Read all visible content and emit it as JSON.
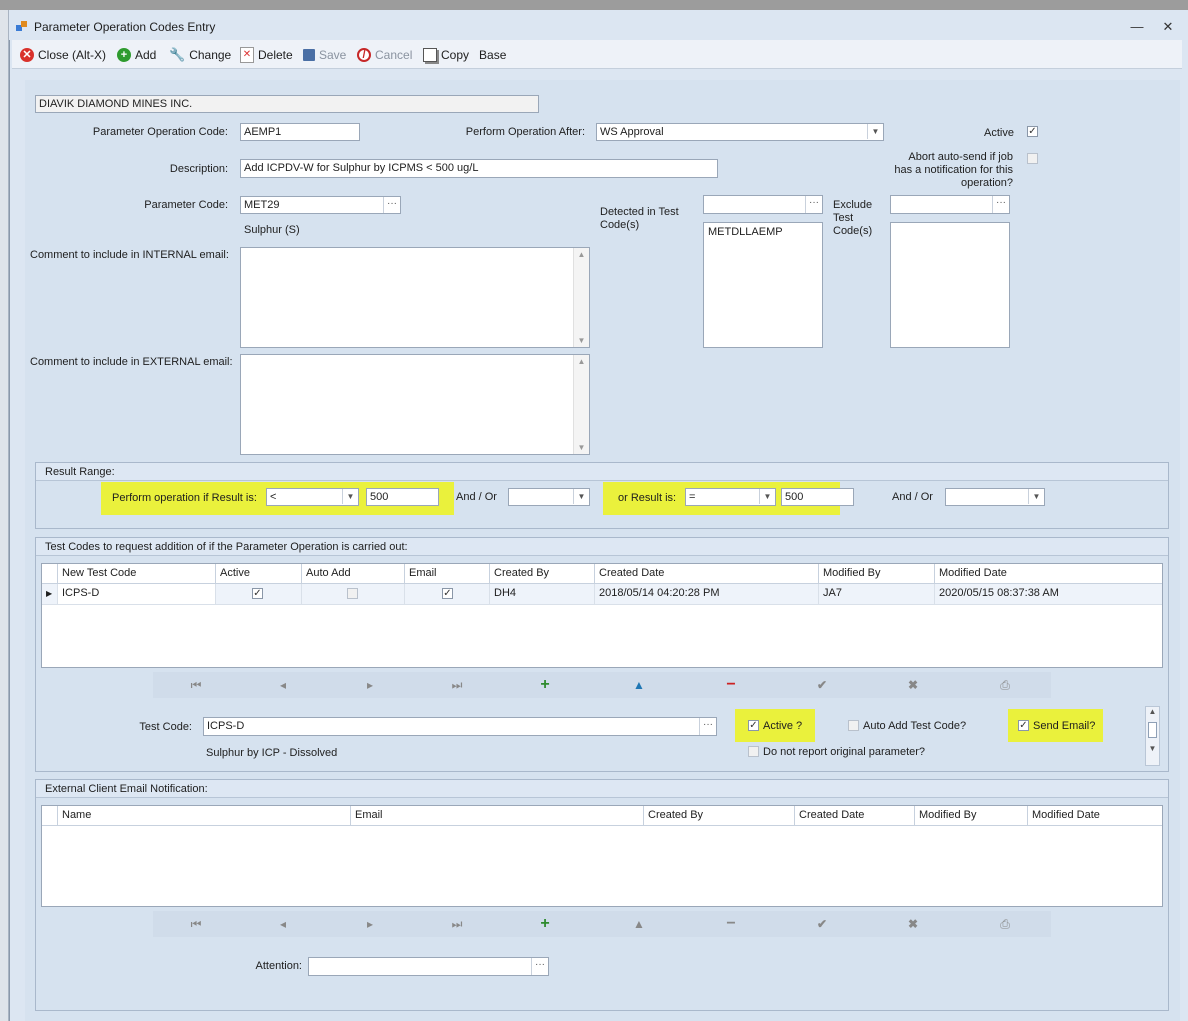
{
  "window": {
    "title": "Parameter Operation Codes Entry",
    "minimize": "—",
    "close": "✕"
  },
  "toolbar": {
    "close_label": "Close (Alt-X)",
    "add_label": "Add",
    "change_label": "Change",
    "delete_label": "Delete",
    "save_label": "Save",
    "cancel_label": "Cancel",
    "copy_label": "Copy",
    "base_label": "Base",
    "icons": {
      "close": "close-circle-icon",
      "add": "plus-circle-icon",
      "change": "wrench-icon",
      "delete": "delete-icon",
      "save": "floppy-icon",
      "cancel": "no-entry-icon",
      "copy": "copy-icon"
    }
  },
  "client_name": "DIAVIK DIAMOND MINES INC.",
  "form": {
    "param_op_code_label": "Parameter Operation Code:",
    "param_op_code": "AEMP1",
    "perform_after_label": "Perform Operation After:",
    "perform_after": "WS Approval",
    "active_label": "Active",
    "active_checked": true,
    "abort_label_1": "Abort auto-send if job",
    "abort_label_2": "has a notification for this",
    "abort_label_3": "operation?",
    "abort_checked": false,
    "description_label": "Description:",
    "description": "Add ICPDV-W for Sulphur by ICPMS < 500 ug/L",
    "param_code_label": "Parameter Code:",
    "param_code": "MET29",
    "param_code_desc": "Sulphur (S)",
    "detected_label_1": "Detected in Test",
    "detected_label_2": "Code(s)",
    "detected_input": "",
    "detected_list": [
      "METDLLAEMP"
    ],
    "exclude_label_1": "Exclude",
    "exclude_label_2": "Test",
    "exclude_label_3": "Code(s)",
    "exclude_input": "",
    "internal_email_label": "Comment to include in INTERNAL email:",
    "external_email_label": "Comment to include in EXTERNAL email:"
  },
  "result_range": {
    "title": "Result Range:",
    "perform_label": "Perform operation if Result is:",
    "op1": "<",
    "value1": "500",
    "andor_label": "And / Or",
    "andor1": "",
    "or_label": "or Result is:",
    "op2": "=",
    "value2": "500",
    "andor_label2": "And / Or",
    "andor2": ""
  },
  "test_codes": {
    "title": "Test Codes to request addition of if the Parameter Operation is carried out:",
    "columns": [
      "New Test Code",
      "Active",
      "Auto Add",
      "Email",
      "Created By",
      "Created Date",
      "Modified By",
      "Modified Date"
    ],
    "rows": [
      {
        "code": "ICPS-D",
        "active": true,
        "auto_add": false,
        "email": true,
        "created_by": "DH4",
        "created_date": "2018/05/14 04:20:28 PM",
        "modified_by": "JA7",
        "modified_date": "2020/05/15 08:37:38 AM"
      }
    ],
    "test_code_label": "Test Code:",
    "test_code": "ICPS-D",
    "test_code_desc": "Sulphur by ICP - Dissolved",
    "active_q": "Active ?",
    "active_q_checked": true,
    "auto_add_q": "Auto Add Test Code?",
    "auto_add_checked": false,
    "send_email_q": "Send Email?",
    "send_email_checked": true,
    "no_report_q": "Do not report original parameter?",
    "no_report_checked": false
  },
  "external": {
    "title": "External Client Email Notification:",
    "columns": [
      "Name",
      "Email",
      "Created By",
      "Created Date",
      "Modified By",
      "Modified Date"
    ],
    "attention_label": "Attention:",
    "attention": ""
  },
  "nav_icons": [
    "first-icon",
    "prev-icon",
    "next-icon",
    "last-icon",
    "add-icon",
    "up-icon",
    "remove-icon",
    "check-icon",
    "cancel-icon",
    "print-icon"
  ],
  "colors": {
    "accent_green": "#2e8b2e",
    "remove_red": "#cc2222",
    "highlight": "#f0f500",
    "panel": "#d6e2ef"
  }
}
